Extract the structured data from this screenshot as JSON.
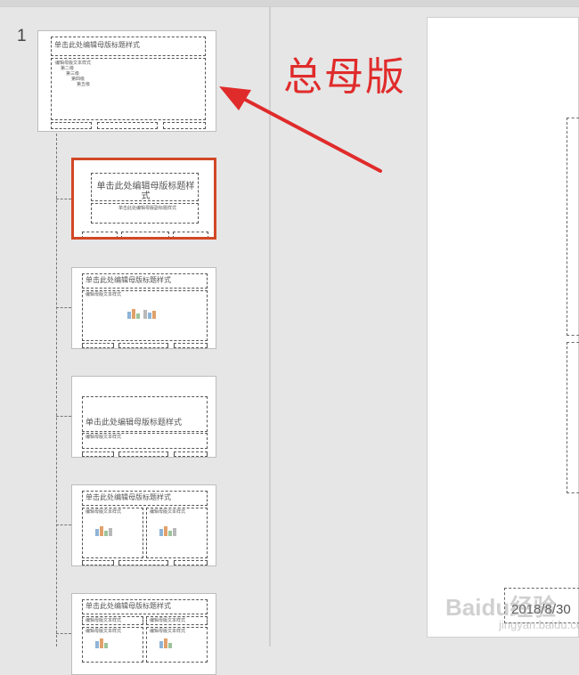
{
  "slide_panel": {
    "slide_number": "1",
    "master": {
      "title": "单击此处编辑母版标题样式",
      "body_levels": [
        "编辑母版文本样式",
        "第二级",
        "第三级",
        "第四级",
        "第五级"
      ]
    },
    "layouts": [
      {
        "title": "单击此处编辑母版标题样式",
        "subtitle": "单击此处编辑母版副标题样式",
        "selected": true
      },
      {
        "title": "单击此处编辑母版标题样式",
        "body": "编辑母版文本样式"
      },
      {
        "title": "单击此处编辑母版标题样式",
        "subtitle": "编辑母版文本样式"
      },
      {
        "title": "单击此处编辑母版标题样式",
        "body": "编辑母版文本样式"
      },
      {
        "title": "单击此处编辑母版标题样式",
        "body": "编辑母版文本样式"
      }
    ]
  },
  "annotation": {
    "label": "总母版",
    "color": "#e02b2b"
  },
  "editor": {
    "date": "2018/8/30"
  },
  "watermark": {
    "brand": "Baidu经验",
    "url": "jingyan.baidu.com"
  },
  "colors": {
    "selection": "#d24726",
    "panel_bg": "#e6e6e6"
  }
}
